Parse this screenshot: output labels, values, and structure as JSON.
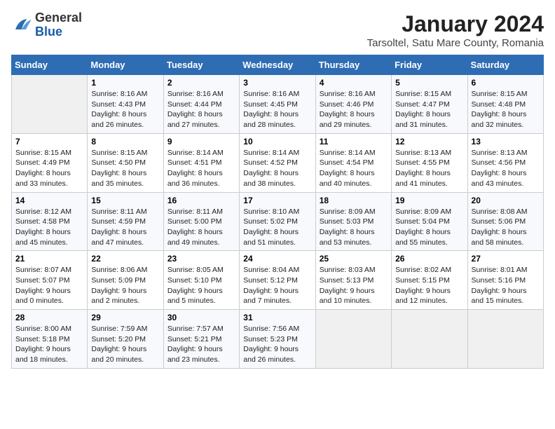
{
  "header": {
    "logo_line1": "General",
    "logo_line2": "Blue",
    "title": "January 2024",
    "subtitle": "Tarsoltel, Satu Mare County, Romania"
  },
  "weekdays": [
    "Sunday",
    "Monday",
    "Tuesday",
    "Wednesday",
    "Thursday",
    "Friday",
    "Saturday"
  ],
  "weeks": [
    [
      {
        "day": "",
        "sunrise": "",
        "sunset": "",
        "daylight": ""
      },
      {
        "day": "1",
        "sunrise": "Sunrise: 8:16 AM",
        "sunset": "Sunset: 4:43 PM",
        "daylight": "Daylight: 8 hours and 26 minutes."
      },
      {
        "day": "2",
        "sunrise": "Sunrise: 8:16 AM",
        "sunset": "Sunset: 4:44 PM",
        "daylight": "Daylight: 8 hours and 27 minutes."
      },
      {
        "day": "3",
        "sunrise": "Sunrise: 8:16 AM",
        "sunset": "Sunset: 4:45 PM",
        "daylight": "Daylight: 8 hours and 28 minutes."
      },
      {
        "day": "4",
        "sunrise": "Sunrise: 8:16 AM",
        "sunset": "Sunset: 4:46 PM",
        "daylight": "Daylight: 8 hours and 29 minutes."
      },
      {
        "day": "5",
        "sunrise": "Sunrise: 8:15 AM",
        "sunset": "Sunset: 4:47 PM",
        "daylight": "Daylight: 8 hours and 31 minutes."
      },
      {
        "day": "6",
        "sunrise": "Sunrise: 8:15 AM",
        "sunset": "Sunset: 4:48 PM",
        "daylight": "Daylight: 8 hours and 32 minutes."
      }
    ],
    [
      {
        "day": "7",
        "sunrise": "Sunrise: 8:15 AM",
        "sunset": "Sunset: 4:49 PM",
        "daylight": "Daylight: 8 hours and 33 minutes."
      },
      {
        "day": "8",
        "sunrise": "Sunrise: 8:15 AM",
        "sunset": "Sunset: 4:50 PM",
        "daylight": "Daylight: 8 hours and 35 minutes."
      },
      {
        "day": "9",
        "sunrise": "Sunrise: 8:14 AM",
        "sunset": "Sunset: 4:51 PM",
        "daylight": "Daylight: 8 hours and 36 minutes."
      },
      {
        "day": "10",
        "sunrise": "Sunrise: 8:14 AM",
        "sunset": "Sunset: 4:52 PM",
        "daylight": "Daylight: 8 hours and 38 minutes."
      },
      {
        "day": "11",
        "sunrise": "Sunrise: 8:14 AM",
        "sunset": "Sunset: 4:54 PM",
        "daylight": "Daylight: 8 hours and 40 minutes."
      },
      {
        "day": "12",
        "sunrise": "Sunrise: 8:13 AM",
        "sunset": "Sunset: 4:55 PM",
        "daylight": "Daylight: 8 hours and 41 minutes."
      },
      {
        "day": "13",
        "sunrise": "Sunrise: 8:13 AM",
        "sunset": "Sunset: 4:56 PM",
        "daylight": "Daylight: 8 hours and 43 minutes."
      }
    ],
    [
      {
        "day": "14",
        "sunrise": "Sunrise: 8:12 AM",
        "sunset": "Sunset: 4:58 PM",
        "daylight": "Daylight: 8 hours and 45 minutes."
      },
      {
        "day": "15",
        "sunrise": "Sunrise: 8:11 AM",
        "sunset": "Sunset: 4:59 PM",
        "daylight": "Daylight: 8 hours and 47 minutes."
      },
      {
        "day": "16",
        "sunrise": "Sunrise: 8:11 AM",
        "sunset": "Sunset: 5:00 PM",
        "daylight": "Daylight: 8 hours and 49 minutes."
      },
      {
        "day": "17",
        "sunrise": "Sunrise: 8:10 AM",
        "sunset": "Sunset: 5:02 PM",
        "daylight": "Daylight: 8 hours and 51 minutes."
      },
      {
        "day": "18",
        "sunrise": "Sunrise: 8:09 AM",
        "sunset": "Sunset: 5:03 PM",
        "daylight": "Daylight: 8 hours and 53 minutes."
      },
      {
        "day": "19",
        "sunrise": "Sunrise: 8:09 AM",
        "sunset": "Sunset: 5:04 PM",
        "daylight": "Daylight: 8 hours and 55 minutes."
      },
      {
        "day": "20",
        "sunrise": "Sunrise: 8:08 AM",
        "sunset": "Sunset: 5:06 PM",
        "daylight": "Daylight: 8 hours and 58 minutes."
      }
    ],
    [
      {
        "day": "21",
        "sunrise": "Sunrise: 8:07 AM",
        "sunset": "Sunset: 5:07 PM",
        "daylight": "Daylight: 9 hours and 0 minutes."
      },
      {
        "day": "22",
        "sunrise": "Sunrise: 8:06 AM",
        "sunset": "Sunset: 5:09 PM",
        "daylight": "Daylight: 9 hours and 2 minutes."
      },
      {
        "day": "23",
        "sunrise": "Sunrise: 8:05 AM",
        "sunset": "Sunset: 5:10 PM",
        "daylight": "Daylight: 9 hours and 5 minutes."
      },
      {
        "day": "24",
        "sunrise": "Sunrise: 8:04 AM",
        "sunset": "Sunset: 5:12 PM",
        "daylight": "Daylight: 9 hours and 7 minutes."
      },
      {
        "day": "25",
        "sunrise": "Sunrise: 8:03 AM",
        "sunset": "Sunset: 5:13 PM",
        "daylight": "Daylight: 9 hours and 10 minutes."
      },
      {
        "day": "26",
        "sunrise": "Sunrise: 8:02 AM",
        "sunset": "Sunset: 5:15 PM",
        "daylight": "Daylight: 9 hours and 12 minutes."
      },
      {
        "day": "27",
        "sunrise": "Sunrise: 8:01 AM",
        "sunset": "Sunset: 5:16 PM",
        "daylight": "Daylight: 9 hours and 15 minutes."
      }
    ],
    [
      {
        "day": "28",
        "sunrise": "Sunrise: 8:00 AM",
        "sunset": "Sunset: 5:18 PM",
        "daylight": "Daylight: 9 hours and 18 minutes."
      },
      {
        "day": "29",
        "sunrise": "Sunrise: 7:59 AM",
        "sunset": "Sunset: 5:20 PM",
        "daylight": "Daylight: 9 hours and 20 minutes."
      },
      {
        "day": "30",
        "sunrise": "Sunrise: 7:57 AM",
        "sunset": "Sunset: 5:21 PM",
        "daylight": "Daylight: 9 hours and 23 minutes."
      },
      {
        "day": "31",
        "sunrise": "Sunrise: 7:56 AM",
        "sunset": "Sunset: 5:23 PM",
        "daylight": "Daylight: 9 hours and 26 minutes."
      },
      {
        "day": "",
        "sunrise": "",
        "sunset": "",
        "daylight": ""
      },
      {
        "day": "",
        "sunrise": "",
        "sunset": "",
        "daylight": ""
      },
      {
        "day": "",
        "sunrise": "",
        "sunset": "",
        "daylight": ""
      }
    ]
  ]
}
